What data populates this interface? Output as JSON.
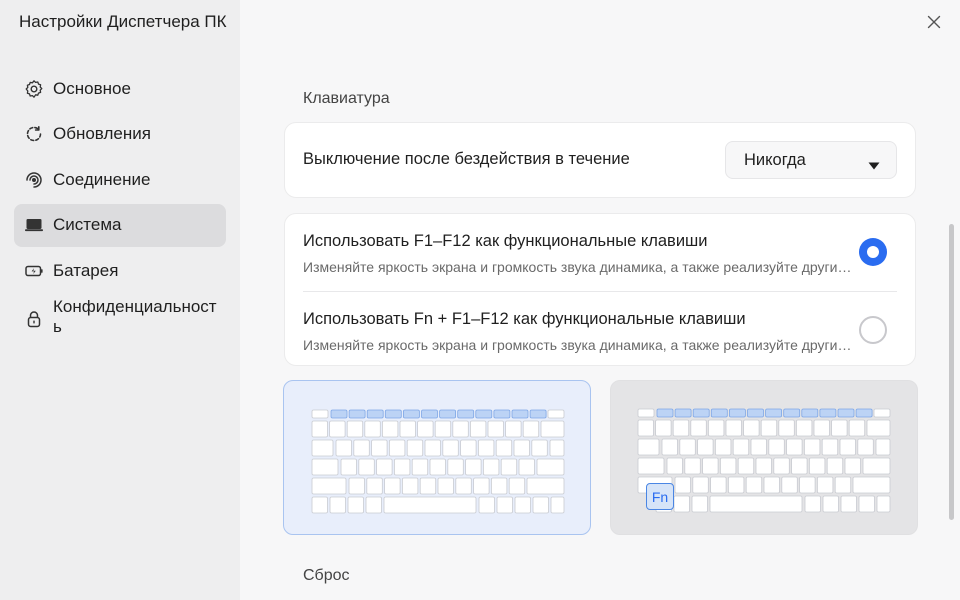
{
  "window": {
    "title": "Настройки Диспетчера ПК"
  },
  "sidebar": {
    "items": [
      {
        "label": "Основное",
        "icon": "gear-icon",
        "active": false
      },
      {
        "label": "Обновления",
        "icon": "refresh-icon",
        "active": false
      },
      {
        "label": "Соединение",
        "icon": "connection-icon",
        "active": false
      },
      {
        "label": "Система",
        "icon": "laptop-icon",
        "active": true
      },
      {
        "label": "Батарея",
        "icon": "battery-icon",
        "active": false
      },
      {
        "label": "Конфиденциальность",
        "icon": "lock-icon",
        "active": false
      }
    ]
  },
  "main": {
    "keyboard_section_title": "Клавиатура",
    "idle_off": {
      "label": "Выключение после бездействия в течение",
      "dropdown_value": "Никогда"
    },
    "fkeys_options": [
      {
        "label": "Использовать F1–F12 как функциональные клавиши",
        "description": "Изменяйте яркость экрана и громкость звука динамика, а также реализуйте другие функции",
        "selected": true
      },
      {
        "label": "Использовать Fn + F1–F12 как функциональные клавиши",
        "description": "Изменяйте яркость экрана и громкость звука динамика, а также реализуйте другие функции",
        "selected": false
      }
    ],
    "fn_key_label": "Fn",
    "reset_section_title": "Сброс"
  },
  "colors": {
    "accent": "#2a6cf0",
    "fkey_highlight": "#bcd3f5",
    "fkey_highlight_border": "#7fa7e6",
    "sidebar_bg": "#eeeeef",
    "sidebar_active_bg": "#dcdcde"
  }
}
